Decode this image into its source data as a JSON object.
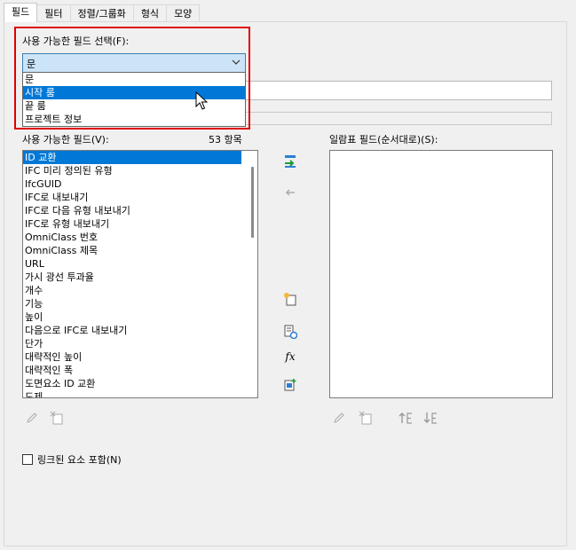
{
  "tabs": [
    {
      "label": "필드"
    },
    {
      "label": "필터"
    },
    {
      "label": "정렬/그룹화"
    },
    {
      "label": "형식"
    },
    {
      "label": "모양"
    }
  ],
  "select_from": {
    "label": "사용 가능한 필드 선택(F):",
    "value": "문",
    "options": [
      "문",
      "시작 룸",
      "끝 룸",
      "프로젝트 정보"
    ],
    "selected_option": "시작 룸"
  },
  "available_fields": {
    "label": "사용 가능한 필드(V):",
    "count": "53 항목",
    "items": [
      "ID 교환",
      "IFC 미리 정의된 유형",
      "IfcGUID",
      "IFC로 내보내기",
      "IFC로 다음 유형 내보내기",
      "IFC로 유형 내보내기",
      "OmniClass 번호",
      "OmniClass 제목",
      "URL",
      "가시 광선 투과율",
      "개수",
      "기능",
      "높이",
      "다음으로 IFC로 내보내기",
      "단가",
      "대략적인 높이",
      "대략적인 폭",
      "도면요소 ID 교환",
      "도제"
    ],
    "selected_item": "ID 교환"
  },
  "scheduled_fields": {
    "label": "일람표 필드(순서대로)(S):",
    "items": []
  },
  "include_linked": {
    "label": "링크된 요소 포함(N)",
    "checked": false
  },
  "colors": {
    "highlight_box": "#e00000",
    "selection": "#0078d7",
    "combo_bg": "#cce4f7"
  }
}
